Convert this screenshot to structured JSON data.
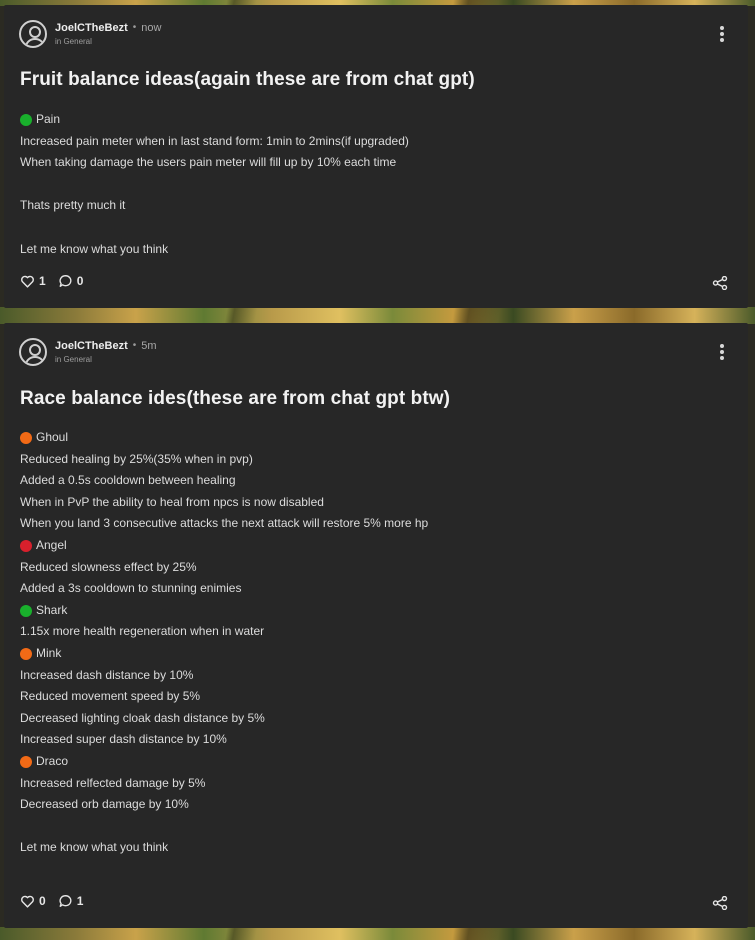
{
  "colors": {
    "card_bg": "#272727",
    "green": "#19b02c",
    "orange": "#f26a16",
    "red": "#d8202c"
  },
  "posts": [
    {
      "author": "JoelCTheBezt",
      "separator": "•",
      "time": "now",
      "category": "in General",
      "title": "Fruit balance ideas(again these are from chat gpt)",
      "lines": [
        {
          "text": "Pain",
          "bullet": "green"
        },
        {
          "text": "Increased pain meter when in last stand form: 1min to 2mins(if upgraded)"
        },
        {
          "text": "When taking damage the users pain meter will fill up by 10% each time"
        },
        {
          "text": ""
        },
        {
          "text": "Thats pretty much it"
        },
        {
          "text": ""
        },
        {
          "text": "Let me know what you think"
        }
      ],
      "likes": "1",
      "comments": "0",
      "icons": {
        "like": "heart-icon",
        "comment": "comment-icon",
        "share": "share-icon",
        "more": "more-vertical-icon",
        "avatar": "user-avatar-icon"
      }
    },
    {
      "author": "JoelCTheBezt",
      "separator": "•",
      "time": "5m",
      "category": "in General",
      "title": "Race balance ides(these are from chat gpt btw)",
      "lines": [
        {
          "text": "Ghoul",
          "bullet": "orange"
        },
        {
          "text": "Reduced healing by 25%(35% when in pvp)"
        },
        {
          "text": "Added a 0.5s cooldown between healing"
        },
        {
          "text": "When in PvP the ability to heal from npcs is now disabled"
        },
        {
          "text": "When you land 3 consecutive attacks the next attack will restore 5% more hp"
        },
        {
          "text": "Angel",
          "bullet": "red"
        },
        {
          "text": "Reduced slowness effect by 25%"
        },
        {
          "text": "Added a 3s cooldown to stunning enimies"
        },
        {
          "text": "Shark",
          "bullet": "green"
        },
        {
          "text": "1.15x more health regeneration when in water"
        },
        {
          "text": "Mink",
          "bullet": "orange"
        },
        {
          "text": "Increased dash distance by 10%"
        },
        {
          "text": "Reduced movement speed by 5%"
        },
        {
          "text": "Decreased lighting cloak dash distance by 5%"
        },
        {
          "text": "Increased super dash distance by 10%"
        },
        {
          "text": "Draco",
          "bullet": "orange"
        },
        {
          "text": "Increased relfected damage by 5%"
        },
        {
          "text": "Decreased orb damage by 10%"
        },
        {
          "text": ""
        },
        {
          "text": "Let me know what you think"
        }
      ],
      "likes": "0",
      "comments": "1",
      "icons": {
        "like": "heart-icon",
        "comment": "comment-icon",
        "share": "share-icon",
        "more": "more-vertical-icon",
        "avatar": "user-avatar-icon"
      }
    }
  ]
}
